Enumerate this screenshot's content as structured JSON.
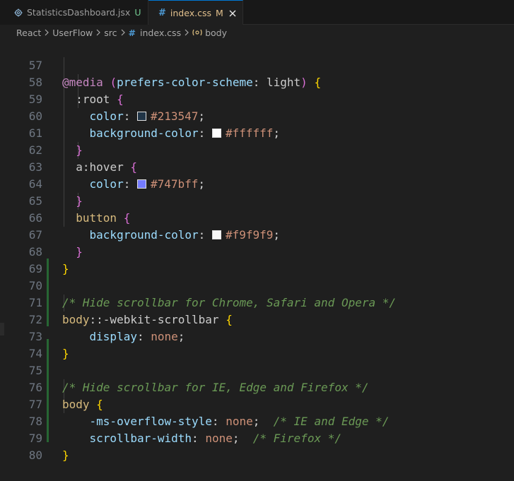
{
  "tabs": [
    {
      "label": "StatisticsDashboard.jsx",
      "status": "U",
      "icon": "gear-icon",
      "active": false
    },
    {
      "label": "index.css",
      "status": "M",
      "icon": "hash-icon",
      "active": true
    }
  ],
  "breadcrumb": {
    "items": [
      "React",
      "UserFlow",
      "src",
      "index.css",
      "body"
    ],
    "file_icon": "#"
  },
  "colors": {
    "swatch_213547": "#213547",
    "swatch_ffffff": "#ffffff",
    "swatch_747bff": "#747bff",
    "swatch_f9f9f9": "#f9f9f9"
  },
  "code": {
    "line_numbers": [
      "57",
      "58",
      "59",
      "60",
      "61",
      "62",
      "63",
      "64",
      "65",
      "66",
      "67",
      "68",
      "69",
      "70",
      "71",
      "72",
      "73",
      "74",
      "75",
      "76",
      "77",
      "78",
      "79",
      "80"
    ],
    "l57": {
      "kw": "@media",
      "open": "(",
      "feat": "prefers-color-scheme",
      "colon": ":",
      "val": " light",
      "close": ")",
      "brace": "{"
    },
    "l58": {
      "sel": ":root",
      "brace": "{"
    },
    "l59": {
      "prop": "color",
      "colon": ":",
      "value": "#213547",
      "semi": ";"
    },
    "l60": {
      "prop": "background-color",
      "colon": ":",
      "value": "#ffffff",
      "semi": ";"
    },
    "l61": {
      "brace": "}"
    },
    "l62": {
      "sel_a": "a",
      "sel_pseudo": ":hover",
      "brace": "{"
    },
    "l63": {
      "prop": "color",
      "colon": ":",
      "value": "#747bff",
      "semi": ";"
    },
    "l64": {
      "brace": "}"
    },
    "l65": {
      "sel": "button",
      "brace": "{"
    },
    "l66": {
      "prop": "background-color",
      "colon": ":",
      "value": "#f9f9f9",
      "semi": ";"
    },
    "l67": {
      "brace": "}"
    },
    "l68": {
      "brace": "}"
    },
    "l70": {
      "comment": "/* Hide scrollbar for Chrome, Safari and Opera */"
    },
    "l71": {
      "sel": "body",
      "pseudo": "::-webkit-scrollbar",
      "brace": "{"
    },
    "l72": {
      "prop": "display",
      "colon": ":",
      "value": "none",
      "semi": ";"
    },
    "l73": {
      "brace": "}"
    },
    "l75": {
      "comment": "/* Hide scrollbar for IE, Edge and Firefox */"
    },
    "l76": {
      "sel": "body",
      "brace": "{"
    },
    "l77": {
      "prop": "-ms-overflow-style",
      "colon": ":",
      "value": "none",
      "semi": ";",
      "comment": "/* IE and Edge */"
    },
    "l78": {
      "prop": "scrollbar-width",
      "colon": ":",
      "value": "none",
      "semi": ";",
      "comment": "/* Firefox */"
    },
    "l79": {
      "brace": "}"
    }
  }
}
